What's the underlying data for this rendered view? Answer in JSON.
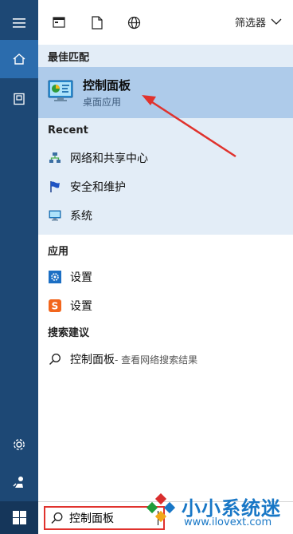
{
  "rail": {
    "items": [
      "menu-icon",
      "home-icon",
      "documents-icon",
      "settings-icon",
      "user-icon",
      "windows-icon"
    ]
  },
  "topbar": {
    "filter_label": "筛选器"
  },
  "best_match": {
    "title": "最佳匹配",
    "name": "控制面板",
    "subtitle": "桌面应用"
  },
  "recent": {
    "title": "Recent",
    "items": [
      {
        "label": "网络和共享中心"
      },
      {
        "label": "安全和维护"
      },
      {
        "label": "系统"
      }
    ]
  },
  "apps": {
    "title": "应用",
    "items": [
      {
        "label": "设置"
      },
      {
        "label": "设置"
      }
    ]
  },
  "suggestions": {
    "title": "搜索建议",
    "query": "控制面板",
    "hint": " - 查看网络搜索结果"
  },
  "search": {
    "value": "控制面板"
  },
  "watermark": {
    "brand": "小小系统迷",
    "url": "www.ilovext.com"
  },
  "colors": {
    "rail": "#1d4875",
    "selected": "#aecbea",
    "panel": "#e3edf7",
    "accent_red": "#e0322d",
    "brand_blue": "#1877c6"
  }
}
